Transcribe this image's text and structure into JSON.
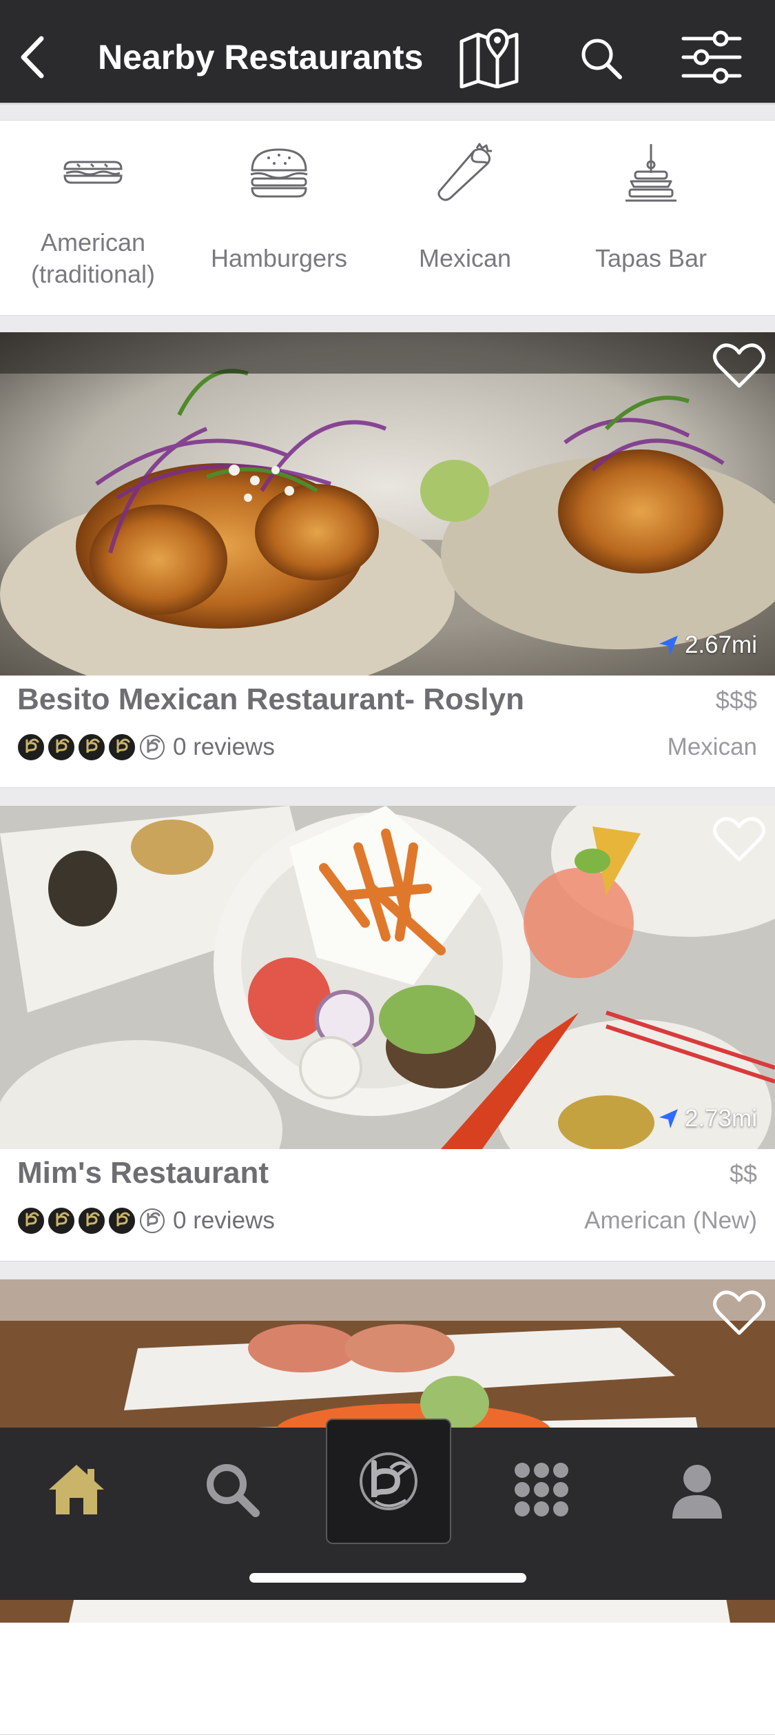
{
  "header": {
    "title": "Nearby Restaurants",
    "back_icon": "chevron-left-icon",
    "map_icon": "map-pin-icon",
    "search_icon": "search-icon",
    "filter_icon": "sliders-icon"
  },
  "categories": [
    {
      "label": "American\n(traditional)",
      "icon": "sandwich-icon"
    },
    {
      "label": "Hamburgers",
      "icon": "hamburger-icon"
    },
    {
      "label": "Mexican",
      "icon": "burrito-icon"
    },
    {
      "label": "Tapas Bar",
      "icon": "tapas-icon"
    }
  ],
  "restaurants": [
    {
      "name": "Besito Mexican Restaurant- Roslyn",
      "price": "$$$",
      "distance": "2.67mi",
      "rating": 4,
      "rating_max": 5,
      "reviews": "0 reviews",
      "cuisine": "Mexican"
    },
    {
      "name": "Mim's Restaurant",
      "price": "$$",
      "distance": "2.73mi",
      "rating": 4,
      "rating_max": 5,
      "reviews": "0 reviews",
      "cuisine": "American (New)"
    },
    {
      "name": "",
      "price": "",
      "distance": "",
      "reviews": "",
      "cuisine": ""
    }
  ],
  "tabbar": {
    "items": [
      "home-icon",
      "search-icon",
      "brand-logo-icon",
      "grid-icon",
      "profile-icon"
    ],
    "active": "home-icon"
  },
  "colors": {
    "header_bg": "#2b2b2e",
    "accent_gold": "#c9b46a",
    "distance_arrow": "#2f6bff",
    "tab_inactive": "#9a9a9e"
  }
}
